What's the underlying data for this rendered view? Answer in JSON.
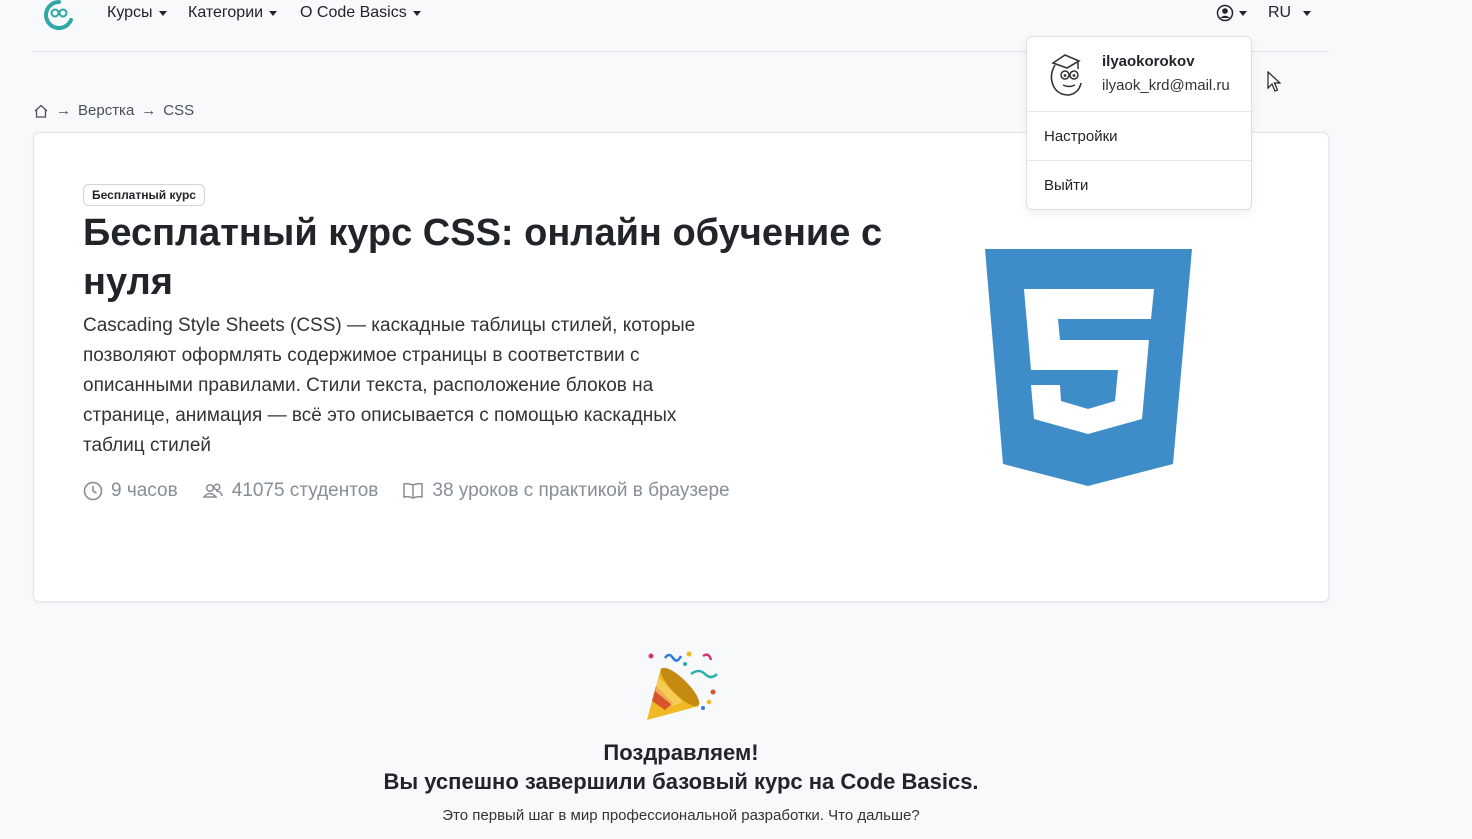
{
  "nav": {
    "courses": "Курсы",
    "categories": "Категории",
    "about": "О Code Basics",
    "lang": "RU"
  },
  "breadcrumb": {
    "items": [
      "Верстка",
      "CSS"
    ],
    "separator": "→"
  },
  "course": {
    "badge": "Бесплатный курс",
    "title": "Бесплатный курс CSS: онлайн обучение с нуля",
    "description": "Cascading Style Sheets (CSS) — каскадные таблицы стилей, которые позволяют оформлять содержимое страницы в соответствии с описанными правилами. Стили текста, расположение блоков на странице, анимация — всё это описывается с помощью каскадных таблиц стилей",
    "duration": "9 часов",
    "students": "41075 студентов",
    "lessons": "38 уроков с практикой в браузере"
  },
  "user_menu": {
    "username": "ilyaokorokov",
    "email": "ilyaok_krd@mail.ru",
    "settings": "Настройки",
    "logout": "Выйти"
  },
  "completion": {
    "line1": "Поздравляем!",
    "line2": "Вы успешно завершили базовый курс на Code Basics.",
    "line3": "Это первый шаг в мир профессиональной разработки. Что дальше?"
  },
  "colors": {
    "accent": "#2fa7a6",
    "css_blue": "#3f8dc8"
  }
}
